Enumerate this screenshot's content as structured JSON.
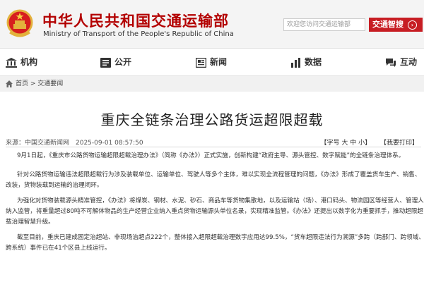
{
  "header": {
    "site_name_cn": "中华人民共和国交通运输部",
    "site_name_en": "Ministry of Transport of the People's Republic of China",
    "search_placeholder": "欢迎您访问交通运输部",
    "brand_button": "交通智搜",
    "brand_color": "#c71d23"
  },
  "nav": {
    "items": [
      {
        "label": "机构",
        "icon": "organization-icon"
      },
      {
        "label": "公开",
        "icon": "folder-icon"
      },
      {
        "label": "新闻",
        "icon": "news-icon"
      },
      {
        "label": "数据",
        "icon": "bar-chart-icon"
      },
      {
        "label": "互动",
        "icon": "chat-icon"
      }
    ]
  },
  "breadcrumb": {
    "text": "首页 > 交通要闻"
  },
  "article": {
    "title": "重庆全链条治理公路货运超限超载",
    "meta": "来源：中国交通新闻网　2025-09-01 08:57:50",
    "font_size_label": "【字号 大 中 小】",
    "print_label": "【我要打印】",
    "paragraphs": [
      "9月1日起，《重庆市公路货物运输超限超载治理办法》（简称《办法》）正式实施，创新构建“政府主导、源头管控、数字赋能”的全链条治理体系。",
      "针对公路货物运输违法超限超载行为涉及装载单位、运输单位、驾驶人等多个主体，难以实现全流程管理的问题，《办法》形成了覆盖货车生产、销售、改装，货物装载到运输的治理闭环。",
      "为强化对货物装载源头精准管控，《办法》将煤炭、钢材、水泥、砂石、商品车等货物集散地，以及运输站（场）、港口码头、物流园区等经营人、管理人纳入监管，将重量超过80吨不可解体物品的生产经营企业纳入重点货物运输源头单位名录，实现精准监管。《办法》还提出以数字化为重要抓手，推动超限超载治理智慧升级。",
      "截至目前，重庆已建成固定治超站、非现场治超点222个，整体接入超限超载治理数字应用达99.5%，“货车超限违法行为溯源”多跨（跨部门、跨领域、跨系统）事件已在41个区县上线运行。"
    ]
  }
}
